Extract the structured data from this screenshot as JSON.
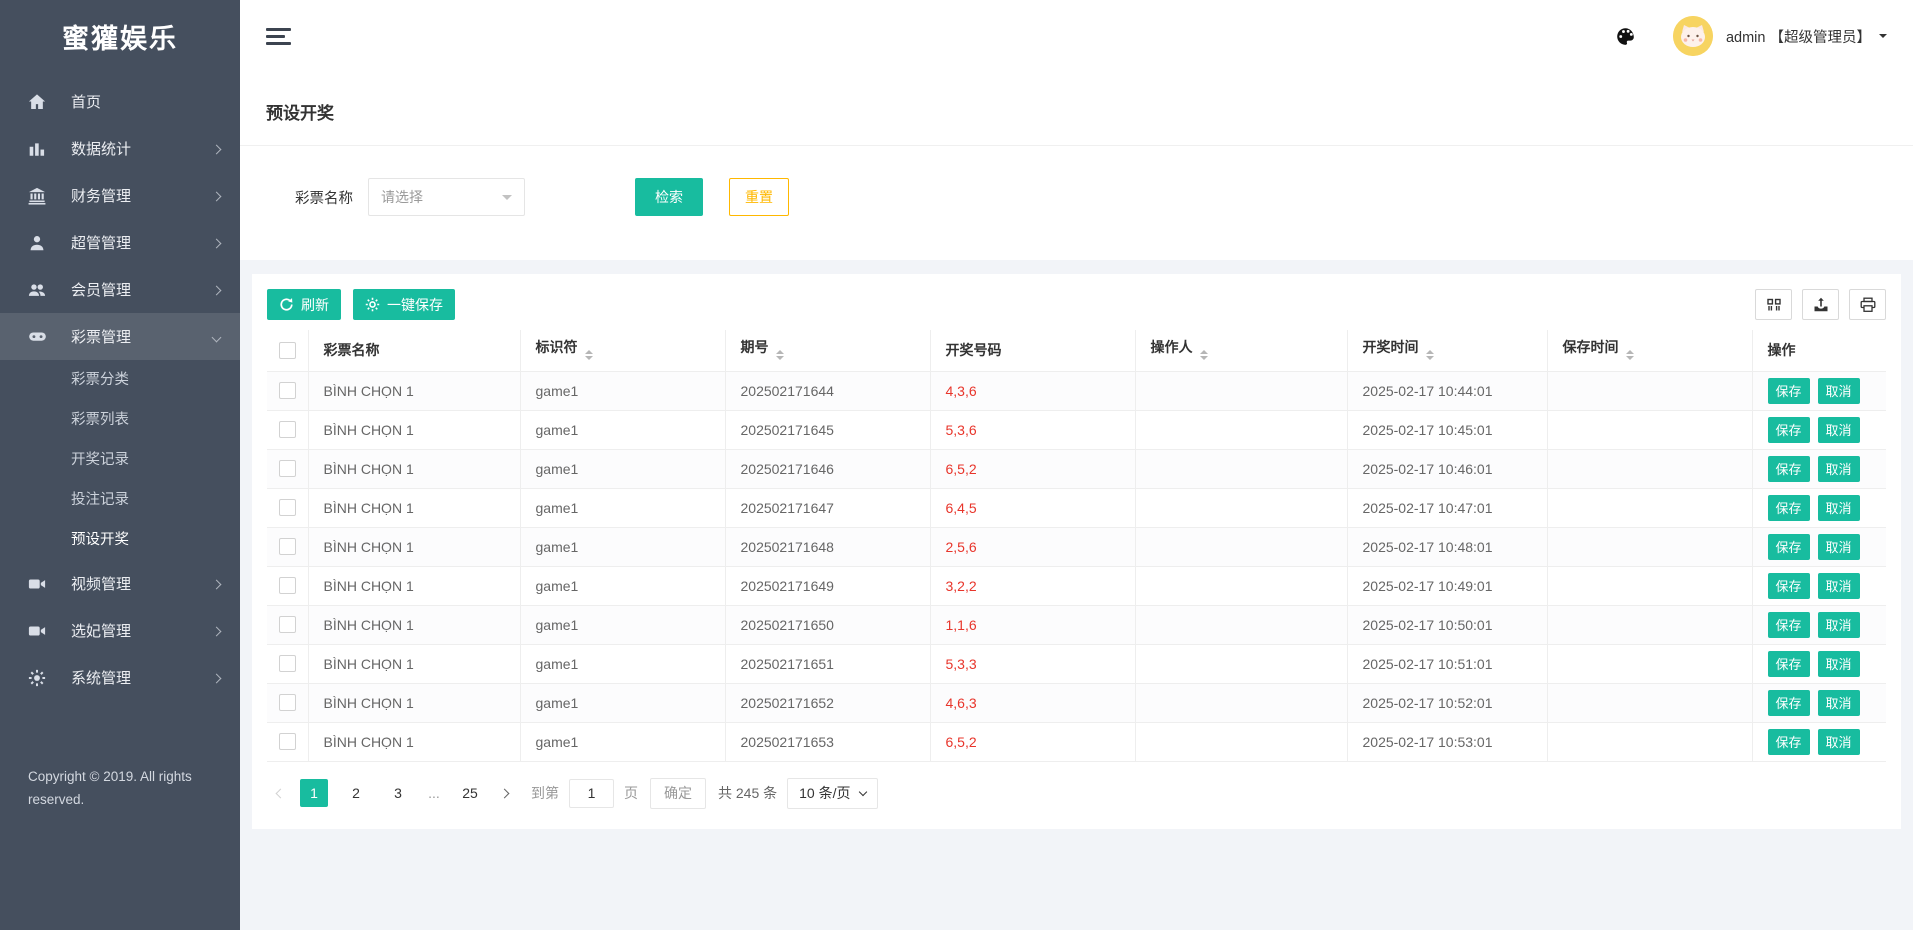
{
  "brand": {
    "title": "蜜獾娱乐"
  },
  "topbar": {
    "user_name": "admin 【超级管理员】"
  },
  "sidebar": {
    "items": [
      {
        "label": "首页"
      },
      {
        "label": "数据统计"
      },
      {
        "label": "财务管理"
      },
      {
        "label": "超管管理"
      },
      {
        "label": "会员管理"
      },
      {
        "label": "彩票管理"
      },
      {
        "label": "视频管理"
      },
      {
        "label": "选妃管理"
      },
      {
        "label": "系统管理"
      }
    ],
    "lottery_submenu": [
      {
        "label": "彩票分类",
        "active": false
      },
      {
        "label": "彩票列表",
        "active": false
      },
      {
        "label": "开奖记录",
        "active": false
      },
      {
        "label": "投注记录",
        "active": false
      },
      {
        "label": "预设开奖",
        "active": true
      }
    ],
    "copyright": "Copyright © 2019. All rights reserved."
  },
  "page": {
    "title": "预设开奖"
  },
  "filter": {
    "label": "彩票名称",
    "select_placeholder": "请选择",
    "search_label": "检索",
    "reset_label": "重置"
  },
  "toolbar": {
    "refresh_label": "刷新",
    "save_all_label": "一键保存"
  },
  "table": {
    "columns": [
      {
        "key": "name",
        "label": "彩票名称",
        "sortable": false
      },
      {
        "key": "code",
        "label": "标识符",
        "sortable": true
      },
      {
        "key": "issue",
        "label": "期号",
        "sortable": true
      },
      {
        "key": "numbers",
        "label": "开奖号码",
        "sortable": false
      },
      {
        "key": "operator",
        "label": "操作人",
        "sortable": true
      },
      {
        "key": "draw_time",
        "label": "开奖时间",
        "sortable": true
      },
      {
        "key": "save_time",
        "label": "保存时间",
        "sortable": true
      },
      {
        "key": "actions",
        "label": "操作",
        "sortable": false
      }
    ],
    "action_save": "保存",
    "action_cancel": "取消",
    "rows": [
      {
        "name": "BÌNH CHỌN 1",
        "code": "game1",
        "issue": "202502171644",
        "numbers": "4,3,6",
        "operator": "",
        "draw_time": "2025-02-17 10:44:01",
        "save_time": ""
      },
      {
        "name": "BÌNH CHỌN 1",
        "code": "game1",
        "issue": "202502171645",
        "numbers": "5,3,6",
        "operator": "",
        "draw_time": "2025-02-17 10:45:01",
        "save_time": ""
      },
      {
        "name": "BÌNH CHỌN 1",
        "code": "game1",
        "issue": "202502171646",
        "numbers": "6,5,2",
        "operator": "",
        "draw_time": "2025-02-17 10:46:01",
        "save_time": ""
      },
      {
        "name": "BÌNH CHỌN 1",
        "code": "game1",
        "issue": "202502171647",
        "numbers": "6,4,5",
        "operator": "",
        "draw_time": "2025-02-17 10:47:01",
        "save_time": ""
      },
      {
        "name": "BÌNH CHỌN 1",
        "code": "game1",
        "issue": "202502171648",
        "numbers": "2,5,6",
        "operator": "",
        "draw_time": "2025-02-17 10:48:01",
        "save_time": ""
      },
      {
        "name": "BÌNH CHỌN 1",
        "code": "game1",
        "issue": "202502171649",
        "numbers": "3,2,2",
        "operator": "",
        "draw_time": "2025-02-17 10:49:01",
        "save_time": ""
      },
      {
        "name": "BÌNH CHỌN 1",
        "code": "game1",
        "issue": "202502171650",
        "numbers": "1,1,6",
        "operator": "",
        "draw_time": "2025-02-17 10:50:01",
        "save_time": ""
      },
      {
        "name": "BÌNH CHỌN 1",
        "code": "game1",
        "issue": "202502171651",
        "numbers": "5,3,3",
        "operator": "",
        "draw_time": "2025-02-17 10:51:01",
        "save_time": ""
      },
      {
        "name": "BÌNH CHỌN 1",
        "code": "game1",
        "issue": "202502171652",
        "numbers": "4,6,3",
        "operator": "",
        "draw_time": "2025-02-17 10:52:01",
        "save_time": ""
      },
      {
        "name": "BÌNH CHỌN 1",
        "code": "game1",
        "issue": "202502171653",
        "numbers": "6,5,2",
        "operator": "",
        "draw_time": "2025-02-17 10:53:01",
        "save_time": ""
      }
    ]
  },
  "pagination": {
    "pages": [
      "1",
      "2",
      "3",
      "...",
      "25"
    ],
    "active_page": "1",
    "goto_label": "到第",
    "goto_value": "1",
    "page_unit": "页",
    "confirm_label": "确定",
    "total_label": "共 245 条",
    "page_size": "10 条/页"
  },
  "colors": {
    "accent": "#18bc9f",
    "warning": "#ffb800",
    "danger": "#e8352b",
    "sidebar": "#454f5e"
  }
}
